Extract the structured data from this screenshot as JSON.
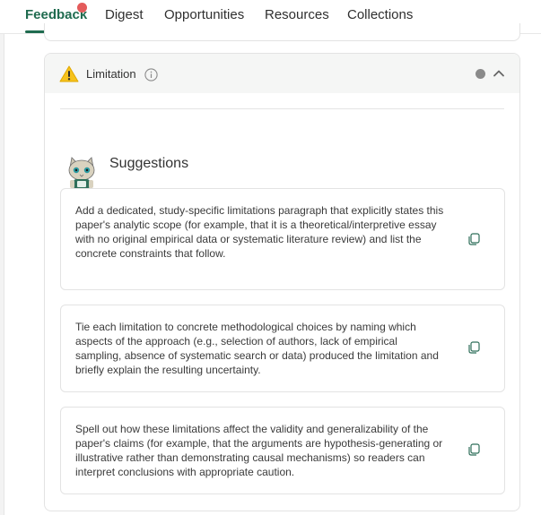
{
  "tabs": [
    {
      "label": "Feedback",
      "active": true
    },
    {
      "label": "Digest"
    },
    {
      "label": "Opportunities"
    },
    {
      "label": "Resources"
    },
    {
      "label": "Collections"
    }
  ],
  "section": {
    "title": "Limitation",
    "icon": "warning-icon",
    "colors": {
      "accent": "#1f6b4f",
      "notification": "#e45b5b",
      "status": "#8a8a8a"
    }
  },
  "suggestions": {
    "heading": "Suggestions",
    "items": [
      {
        "text": "Add a dedicated, study-specific limitations paragraph that explicitly states this paper's analytic scope (for example, that it is a theoretical/interpretive essay with no original empirical data or systematic literature review) and list the concrete constraints that follow."
      },
      {
        "text": "Tie each limitation to concrete methodological choices by naming which aspects of the approach (e.g., selection of authors, lack of empirical sampling, absence of systematic search or data) produced the limitation and briefly explain the resulting uncertainty."
      },
      {
        "text": "Spell out how these limitations affect the validity and generalizability of the paper's claims (for example, that the arguments are hypothesis-generating or illustrative rather than demonstrating causal mechanisms) so readers can interpret conclusions with appropriate caution."
      }
    ]
  }
}
